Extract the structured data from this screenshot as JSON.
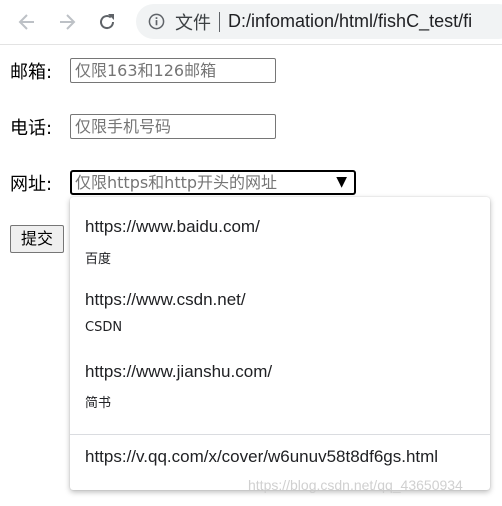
{
  "browser": {
    "back_icon": "arrow-left-icon",
    "forward_icon": "arrow-right-icon",
    "reload_icon": "reload-icon",
    "info_icon": "info-circle-icon",
    "origin_label": "文件",
    "url": "D:/infomation/html/fishC_test/fi"
  },
  "form": {
    "email": {
      "label": "邮箱:",
      "placeholder": "仅限163和126邮箱"
    },
    "phone": {
      "label": "电话:",
      "placeholder": "仅限手机号码"
    },
    "website": {
      "label": "网址:",
      "placeholder": "仅限https和http开头的网址",
      "arrow": "▼"
    },
    "submit_label": "提交"
  },
  "datalist": {
    "options": [
      {
        "value": "https://www.baidu.com/",
        "label": "百度"
      },
      {
        "value": "https://www.csdn.net/",
        "label": "CSDN"
      },
      {
        "value": "https://www.jianshu.com/",
        "label": "简书"
      }
    ],
    "extra_option": "https://v.qq.com/x/cover/w6unuv58t8df6gs.html"
  },
  "watermark": "https://blog.csdn.net/qq_43650934",
  "colors": {
    "toolbar_icon": "#5f6368",
    "omnibox_bg": "#f1f3f4",
    "popup_divider": "#dadce0"
  }
}
